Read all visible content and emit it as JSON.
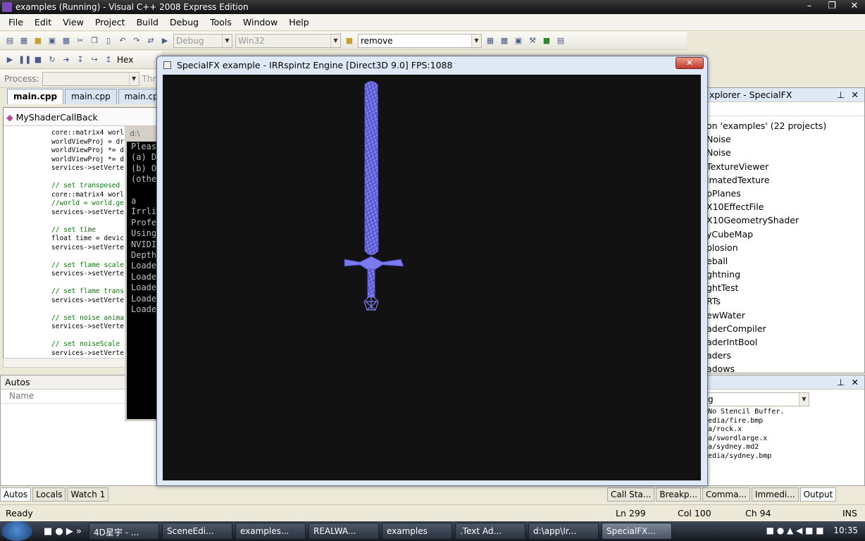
{
  "window": {
    "title": "examples (Running) - Visual C++ 2008 Express Edition"
  },
  "menu": [
    "File",
    "Edit",
    "View",
    "Project",
    "Build",
    "Debug",
    "Tools",
    "Window",
    "Help"
  ],
  "toolbar": {
    "config": "Debug",
    "platform": "Win32",
    "find": "remove",
    "hex_label": "Hex"
  },
  "debug_location": {
    "process_label": "Process:",
    "thread_label": "Thr"
  },
  "editor_tabs": [
    "main.cpp",
    "main.cpp",
    "main.cpp"
  ],
  "editor": {
    "class_nav": "MyShaderCallBack",
    "code": [
      {
        "t": "core::matrix4 worl",
        "c": false
      },
      {
        "t": "worldViewProj = dr",
        "c": false
      },
      {
        "t": "worldViewProj *= d",
        "c": false
      },
      {
        "t": "worldViewProj *= d",
        "c": false
      },
      {
        "t": "services->setVerte",
        "c": false
      },
      {
        "t": "",
        "c": false
      },
      {
        "t": "// set transposed ",
        "c": true
      },
      {
        "t": "core::matrix4 worl",
        "c": false
      },
      {
        "t": "//world = world.ge",
        "c": true
      },
      {
        "t": "services->setVerte",
        "c": false
      },
      {
        "t": "",
        "c": false
      },
      {
        "t": "// set time",
        "c": true
      },
      {
        "t": "float time = devic",
        "c": false
      },
      {
        "t": "services->setVerte",
        "c": false
      },
      {
        "t": "",
        "c": false
      },
      {
        "t": "// set flame scale",
        "c": true
      },
      {
        "t": "services->setVerte",
        "c": false
      },
      {
        "t": "",
        "c": false
      },
      {
        "t": "// set flame trans",
        "c": true
      },
      {
        "t": "services->setVerte",
        "c": false
      },
      {
        "t": "",
        "c": false
      },
      {
        "t": "// set noise anima",
        "c": true
      },
      {
        "t": "services->setVerte",
        "c": false
      },
      {
        "t": "",
        "c": false
      },
      {
        "t": "// set noiseScale ",
        "c": true
      },
      {
        "t": "services->setVerte",
        "c": false
      }
    ]
  },
  "autos": {
    "title": "Autos",
    "col_name": "Name"
  },
  "console": {
    "title": "d:\\",
    "lines": [
      "Pleas",
      "(a) D",
      "(b) O",
      "(othe",
      "",
      "a",
      "Irrli",
      "Profe",
      "Using",
      "NVIDI",
      "Depth",
      "Loade",
      "Loade",
      "Loade",
      "Loade",
      "Loade"
    ]
  },
  "game_window": {
    "title": "SpecialFX example - IRRspintz Engine [Direct3D 9.0] FPS:1088",
    "close": "✕"
  },
  "solution_explorer": {
    "title": "xplorer - SpecialFX",
    "items": [
      "on 'examples' (22 projects)",
      "Noise",
      "Noise",
      "TextureViewer",
      "imatedTexture",
      "pPlanes",
      "X10EffectFile",
      "X10GeometryShader",
      "yCubeMap",
      "plosion",
      "eball",
      "ghtning",
      "ghtTest",
      "RTs",
      "ewWater",
      "aderCompiler",
      "aderIntBool",
      "aders",
      "adows"
    ]
  },
  "output": {
    "show_from": "g",
    "lines": [
      "No Stencil Buffer.",
      "edia/fire.bmp",
      "a/rock.x",
      "a/swordlarge.x",
      "a/sydney.md2",
      "edia/sydney.bmp"
    ]
  },
  "bottom_tabs_left": [
    "Autos",
    "Locals",
    "Watch 1"
  ],
  "bottom_tabs_right": [
    "Call Sta...",
    "Breakp...",
    "Comma...",
    "Immedi...",
    "Output"
  ],
  "status": {
    "ready": "Ready",
    "ln": "Ln 299",
    "col": "Col 100",
    "ch": "Ch 94",
    "ins": "INS"
  },
  "taskbar": {
    "tasks": [
      "4D星宇 - ...",
      "SceneEdi...",
      "examples...",
      "REALWA...",
      "examples",
      ".Text Ad...",
      "d:\\app\\Ir...",
      "SpecialFX..."
    ],
    "active_index": 7,
    "clock": "10:35"
  },
  "colors": {
    "sword": "#7b7bf0",
    "viewport": "#121212",
    "accent": "#2b579a"
  }
}
